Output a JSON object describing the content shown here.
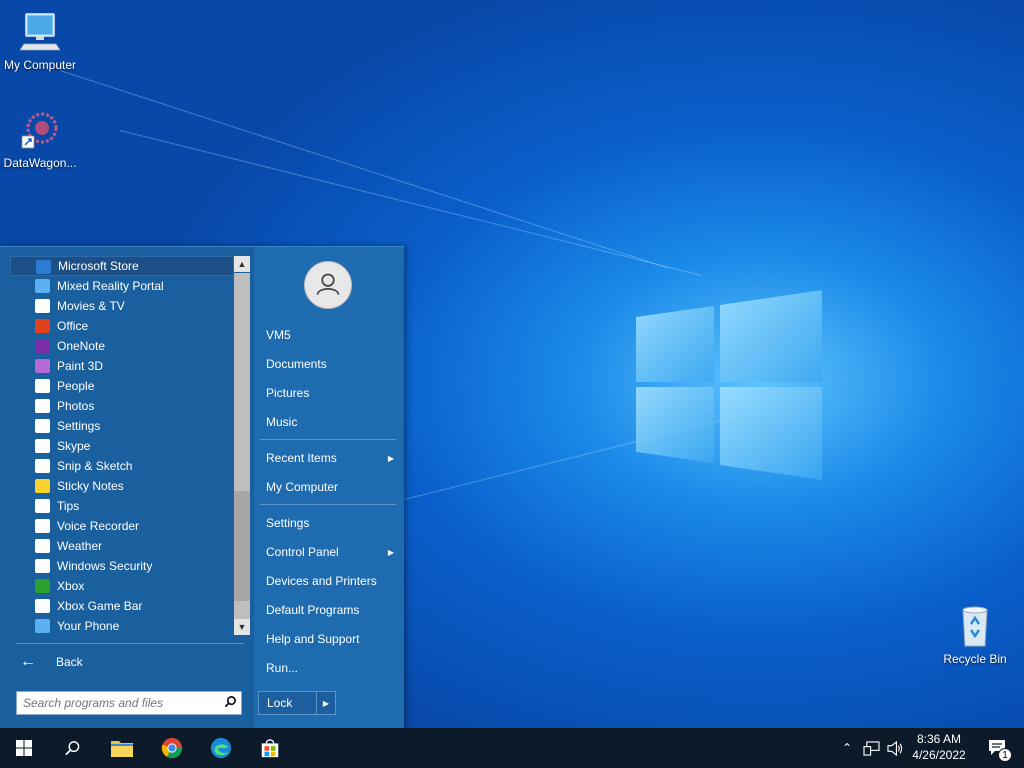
{
  "desktop": {
    "icons": [
      {
        "label": "My Computer",
        "icon": "computer-icon"
      },
      {
        "label": "DataWagon...",
        "icon": "datawagon-icon"
      },
      {
        "label": "Recycle Bin",
        "icon": "recycle-bin-icon"
      }
    ]
  },
  "start_menu": {
    "apps": [
      {
        "label": "Microsoft Store",
        "icon": "store-icon",
        "color": "#2b7cd3",
        "selected": true
      },
      {
        "label": "Mixed Reality Portal",
        "icon": "mixed-reality-icon",
        "color": "#5ab0f0"
      },
      {
        "label": "Movies & TV",
        "icon": "movies-icon",
        "color": "#ffffff"
      },
      {
        "label": "Office",
        "icon": "office-icon",
        "color": "#e2411d"
      },
      {
        "label": "OneNote",
        "icon": "onenote-icon",
        "color": "#7a2fa8"
      },
      {
        "label": "Paint 3D",
        "icon": "paint3d-icon",
        "color": "#b56ad8"
      },
      {
        "label": "People",
        "icon": "people-icon",
        "color": "#ffffff"
      },
      {
        "label": "Photos",
        "icon": "photos-icon",
        "color": "#ffffff"
      },
      {
        "label": "Settings",
        "icon": "settings-icon",
        "color": "#ffffff"
      },
      {
        "label": "Skype",
        "icon": "skype-icon",
        "color": "#ffffff"
      },
      {
        "label": "Snip & Sketch",
        "icon": "snip-icon",
        "color": "#ffffff"
      },
      {
        "label": "Sticky Notes",
        "icon": "sticky-notes-icon",
        "color": "#f8d22a"
      },
      {
        "label": "Tips",
        "icon": "tips-icon",
        "color": "#ffffff"
      },
      {
        "label": "Voice Recorder",
        "icon": "voice-recorder-icon",
        "color": "#ffffff"
      },
      {
        "label": "Weather",
        "icon": "weather-icon",
        "color": "#ffffff"
      },
      {
        "label": "Windows Security",
        "icon": "shield-icon",
        "color": "#ffffff"
      },
      {
        "label": "Xbox",
        "icon": "xbox-icon",
        "color": "#2ca02c"
      },
      {
        "label": "Xbox Game Bar",
        "icon": "game-bar-icon",
        "color": "#ffffff"
      },
      {
        "label": "Your Phone",
        "icon": "phone-icon",
        "color": "#5ab0f0"
      }
    ],
    "back_label": "Back",
    "search_placeholder": "Search programs and files",
    "right": {
      "user": "VM5",
      "documents": "Documents",
      "pictures": "Pictures",
      "music": "Music",
      "recent_items": "Recent Items",
      "my_computer": "My Computer",
      "settings": "Settings",
      "control_panel": "Control Panel",
      "devices_printers": "Devices and Printers",
      "default_programs": "Default Programs",
      "help_support": "Help and Support",
      "run": "Run...",
      "lock": "Lock"
    }
  },
  "taskbar": {
    "time": "8:36 AM",
    "date": "4/26/2022",
    "notification_count": "1"
  },
  "colors": {
    "start_menu_bg": "#1c66a8",
    "taskbar_bg": "#0c1a2a",
    "selection": "#1d4f86"
  }
}
